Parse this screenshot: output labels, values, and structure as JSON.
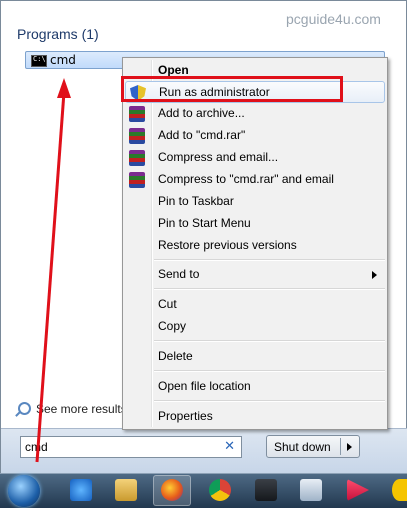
{
  "watermark": "pcguide4u.com",
  "programs": {
    "section_title": "Programs (1)",
    "items": [
      {
        "label": "cmd",
        "icon": "cmd-icon"
      }
    ]
  },
  "context_menu": {
    "open": "Open",
    "run_as_admin": "Run as administrator",
    "add_to_archive": "Add to archive...",
    "add_to_rar": "Add to \"cmd.rar\"",
    "compress_email": "Compress and email...",
    "compress_rar_email": "Compress to \"cmd.rar\" and email",
    "pin_taskbar": "Pin to Taskbar",
    "pin_start": "Pin to Start Menu",
    "restore_versions": "Restore previous versions",
    "send_to": "Send to",
    "cut": "Cut",
    "copy": "Copy",
    "delete": "Delete",
    "open_location": "Open file location",
    "properties": "Properties"
  },
  "see_more": "See more results",
  "search": {
    "value": "cmd"
  },
  "shutdown": {
    "label": "Shut down"
  },
  "colors": {
    "highlight_box": "#e0101a",
    "arrow": "#e0101a"
  },
  "taskbar_icons": [
    "start-orb",
    "internet-explorer-icon",
    "file-explorer-icon",
    "firefox-icon",
    "chrome-icon",
    "media-player-icon",
    "notepad-icon",
    "music-app-icon",
    "app-icon"
  ]
}
